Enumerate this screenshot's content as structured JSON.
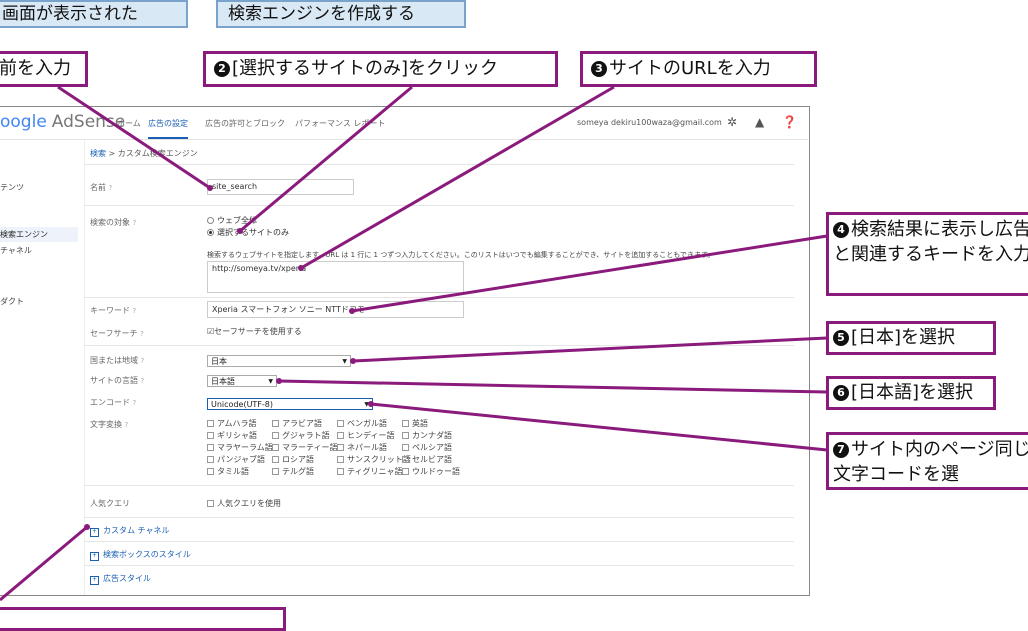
{
  "headers": {
    "left": "画面が表示された",
    "right": "検索エンジンを作成する"
  },
  "callouts": [
    {
      "num": "",
      "text": "前を入力"
    },
    {
      "num": "2",
      "text": "[選択するサイトのみ]をクリック"
    },
    {
      "num": "3",
      "text": "サイトのURLを入力"
    },
    {
      "num": "4",
      "text": "検索結果に表示し広告と関連するキードを入力"
    },
    {
      "num": "5",
      "text": "[日本]を選択"
    },
    {
      "num": "6",
      "text": "[日本語]を選択"
    },
    {
      "num": "7",
      "text": "サイト内のページ同じ文字コードを選"
    },
    {
      "num": "",
      "text": ""
    }
  ],
  "app": {
    "logo_google": "oogle",
    "logo_adsense": "AdSense",
    "nav": [
      "ホーム",
      "広告の設定",
      "広告の許可とブロック",
      "パフォーマンス レポート"
    ],
    "account": "someya dekiru100waza@gmail.com",
    "icons": [
      "gear-icon",
      "bell-icon",
      "help-icon"
    ]
  },
  "sidebar": {
    "items": [
      "テンツ",
      "検索エンジン",
      "チャネル",
      "ダクト"
    ]
  },
  "breadcrumb": {
    "root": "検索",
    "sep": " > ",
    "current": "カスタム検索エンジン"
  },
  "form": {
    "name_label": "名前",
    "name_value": "site_search",
    "target_label": "検索の対象",
    "radio_web": "ウェブ全体",
    "radio_sites": "選択するサイトのみ",
    "help_text": "検索するウェブサイトを指定します。URL は 1 行に 1 つずつ入力してください。このリストはいつでも編集することができ、サイトを追加することもできます。",
    "sites_value": "http://someya.tv/xperia",
    "keywords_label": "キーワード",
    "keywords_value": "Xperia スマートフォン ソニー NTTドコモ",
    "safesearch_label": "セーフサーチ",
    "safesearch_check": "セーフサーチを使用する",
    "country_label": "国または地域",
    "country_value": "日本",
    "lang_label": "サイトの言語",
    "lang_value": "日本語",
    "encoding_label": "エンコード",
    "encoding_value": "Unicode(UTF-8)",
    "translit_label": "文字変換",
    "translit_options": [
      [
        "アムハラ語",
        "アラビア語",
        "ベンガル語",
        "英語"
      ],
      [
        "ギリシャ語",
        "グジャラト語",
        "ヒンディー語",
        "カンナダ語"
      ],
      [
        "マラヤーラム語",
        "マラーティー語",
        "ネパール語",
        "ペルシア語"
      ],
      [
        "パンジャブ語",
        "ロシア語",
        "サンスクリット語",
        "セルビア語"
      ],
      [
        "タミル語",
        "テルグ語",
        "ティグリニャ語",
        "ウルドゥー語"
      ]
    ],
    "popular_label": "人気クエリ",
    "popular_check": "人気クエリを使用"
  },
  "sections": [
    "カスタム チャネル",
    "検索ボックスのスタイル",
    "広告スタイル"
  ],
  "colors": {
    "callout_border": "#8a1a7b",
    "header_bg": "#d9e8f5",
    "link": "#1a5fb4"
  }
}
